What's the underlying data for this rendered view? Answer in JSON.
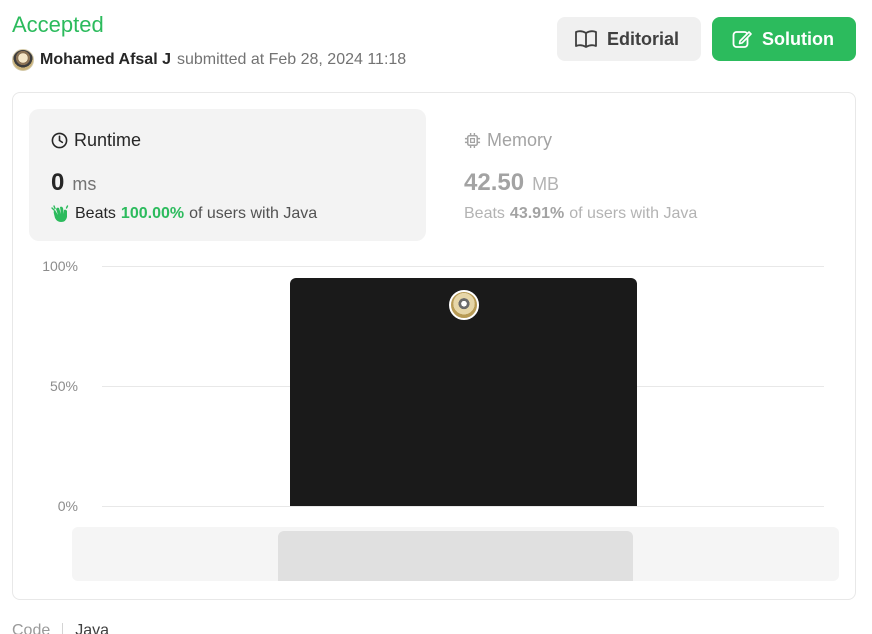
{
  "result": {
    "status": "Accepted",
    "status_color": "#2cbb5d",
    "user": "Mohamed Afsal J",
    "submitted_text": "submitted at Feb 28, 2024 11:18"
  },
  "buttons": {
    "editorial_label": "Editorial",
    "solution_label": "Solution"
  },
  "runtime": {
    "title": "Runtime",
    "value": "0",
    "unit": "ms",
    "beats_prefix": "Beats",
    "beats_pct": "100.00%",
    "beats_suffix": "of users with Java",
    "icon": "clock-icon"
  },
  "memory": {
    "title": "Memory",
    "value": "42.50",
    "unit": "MB",
    "beats_prefix": "Beats",
    "beats_pct": "43.91%",
    "beats_suffix": "of users with Java",
    "icon": "chip-icon"
  },
  "chart_data": {
    "type": "bar",
    "y_ticks": [
      "100%",
      "50%",
      "0%"
    ],
    "ylim": [
      0,
      100
    ],
    "bars": [
      {
        "value": 95,
        "color": "#1a1a1a",
        "has_user_avatar": true
      }
    ],
    "grid": true
  },
  "tabs": {
    "code_label": "Code",
    "language": "Java"
  }
}
